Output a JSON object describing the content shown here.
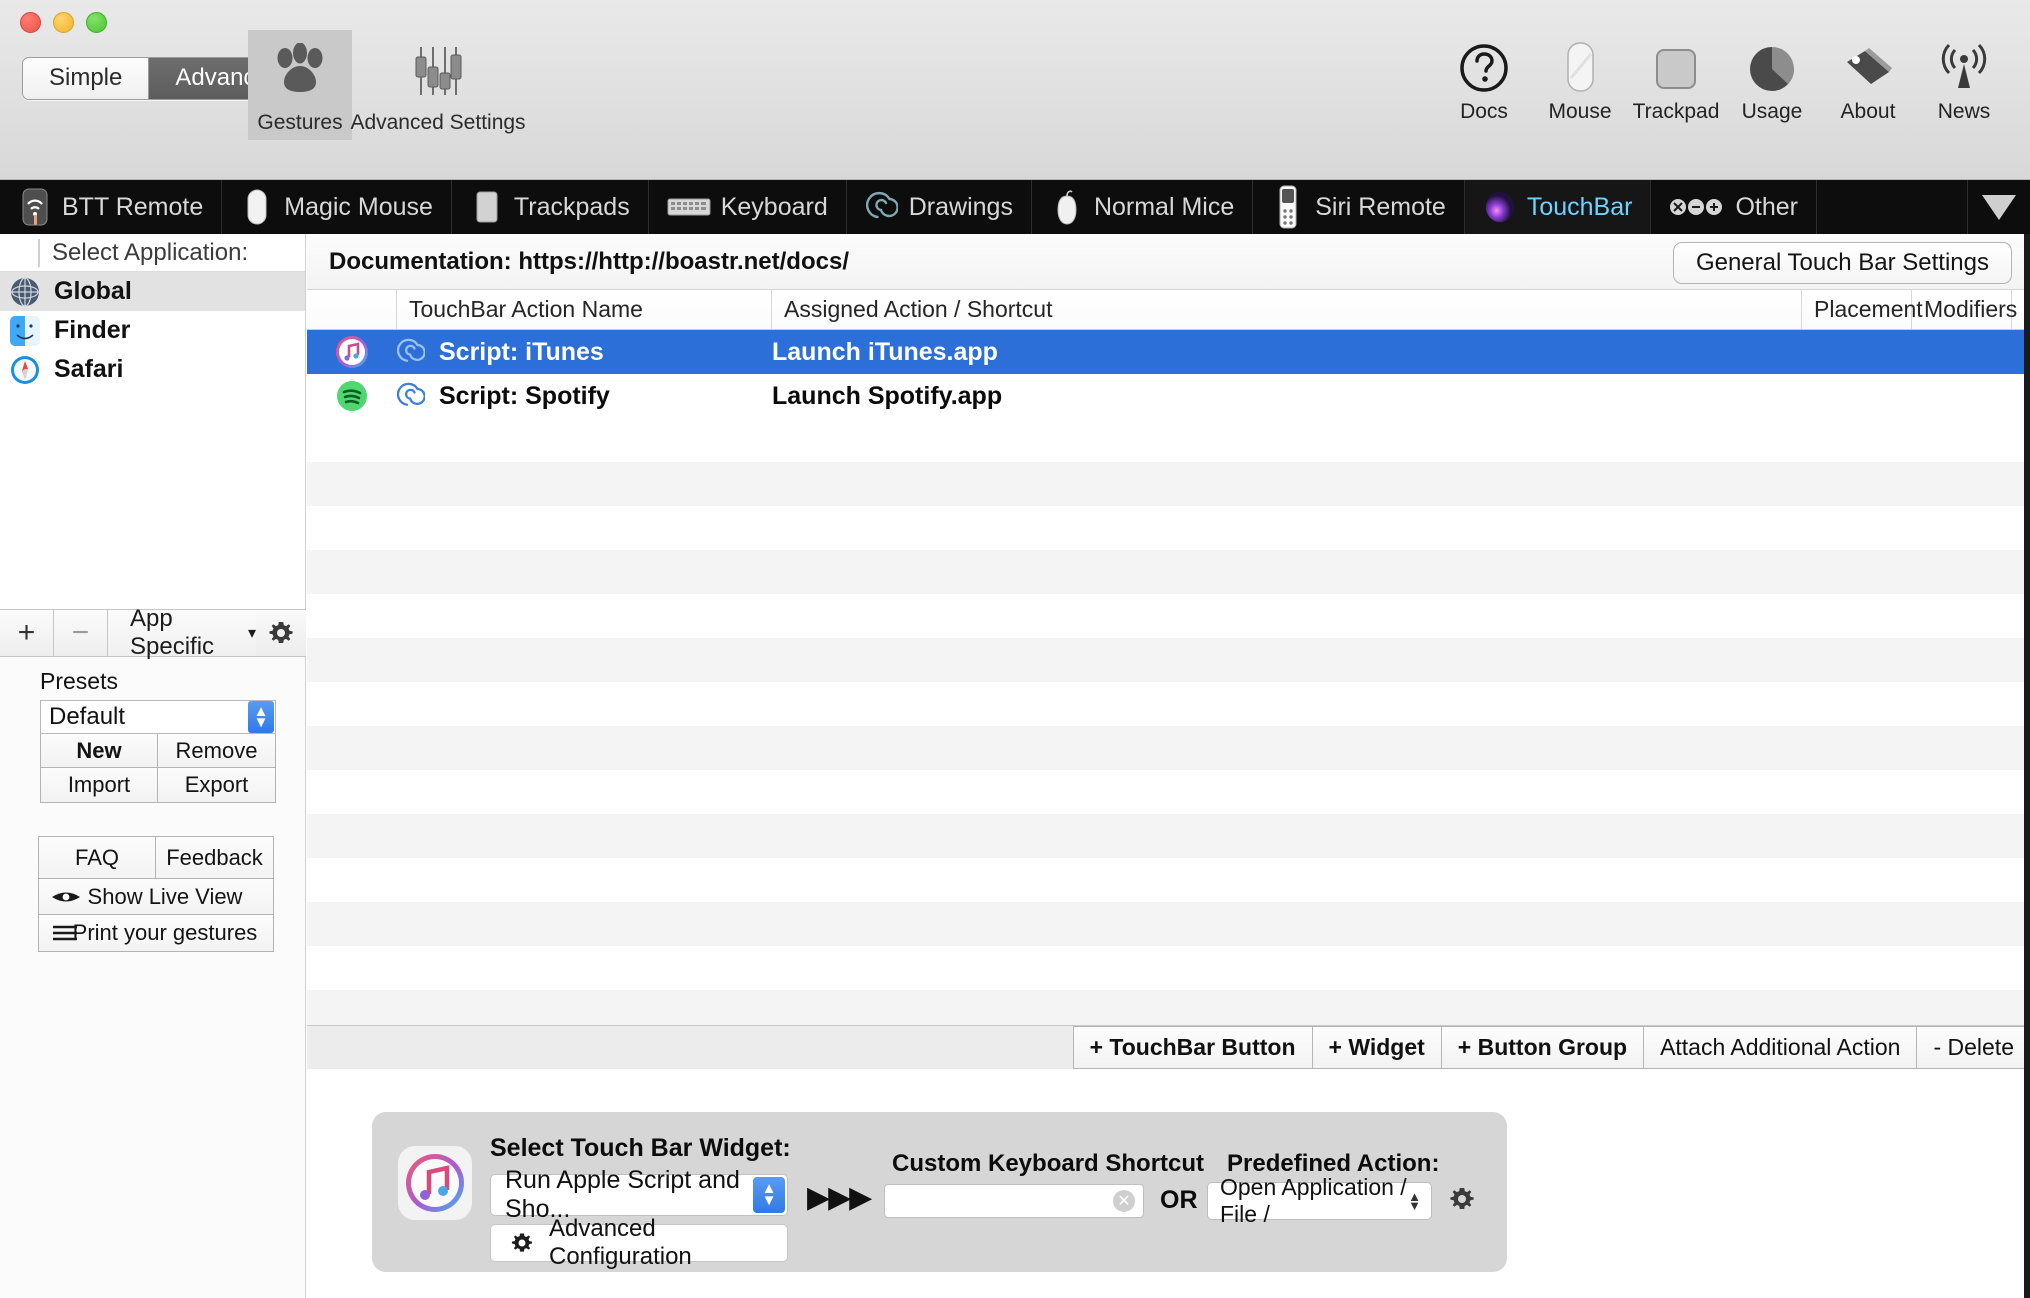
{
  "window": {
    "traffic_lights": [
      "close",
      "minimize",
      "zoom"
    ]
  },
  "toolbar": {
    "mode_segments": [
      {
        "label": "Simple",
        "active": false
      },
      {
        "label": "Advanced",
        "active": true
      }
    ],
    "left_items": [
      {
        "label": "Gestures",
        "icon": "paw-icon",
        "selected": true
      },
      {
        "label": "Advanced Settings",
        "icon": "sliders-icon",
        "selected": false
      }
    ],
    "right_items": [
      {
        "label": "Docs",
        "icon": "question-circle-icon"
      },
      {
        "label": "Mouse",
        "icon": "mouse-icon"
      },
      {
        "label": "Trackpad",
        "icon": "trackpad-icon"
      },
      {
        "label": "Usage",
        "icon": "pie-chart-icon"
      },
      {
        "label": "About",
        "icon": "tag-icon"
      },
      {
        "label": "News",
        "icon": "broadcast-icon"
      }
    ]
  },
  "device_tabs": {
    "items": [
      {
        "label": "BTT Remote",
        "icon": "btt-remote-icon",
        "active": false
      },
      {
        "label": "Magic Mouse",
        "icon": "magic-mouse-icon",
        "active": false
      },
      {
        "label": "Trackpads",
        "icon": "trackpad-icon",
        "active": false
      },
      {
        "label": "Keyboard",
        "icon": "keyboard-icon",
        "active": false
      },
      {
        "label": "Drawings",
        "icon": "spiral-icon",
        "active": false
      },
      {
        "label": "Normal Mice",
        "icon": "normal-mouse-icon",
        "active": false
      },
      {
        "label": "Siri Remote",
        "icon": "siri-remote-icon",
        "active": false
      },
      {
        "label": "TouchBar",
        "icon": "touchbar-orb-icon",
        "active": true
      },
      {
        "label": "Other",
        "icon": "other-dots-icon",
        "active": false
      }
    ],
    "overflow_icon": "triangle-down-icon",
    "active_color": "#6fd2ff"
  },
  "sidebar": {
    "header": "Select Application:",
    "apps": [
      {
        "label": "Global",
        "icon": "globe-icon",
        "selected": true
      },
      {
        "label": "Finder",
        "icon": "finder-icon",
        "selected": false
      },
      {
        "label": "Safari",
        "icon": "safari-icon",
        "selected": false
      }
    ],
    "toolbar": {
      "add_label": "+",
      "remove_label": "−",
      "popup_label": "App Specific",
      "popup_caret": "▾",
      "gear_icon": "gear-icon"
    },
    "presets": {
      "title": "Presets",
      "selected": "Default",
      "buttons": [
        {
          "label": "New",
          "bold": true
        },
        {
          "label": "Remove",
          "bold": false
        },
        {
          "label": "Import",
          "bold": false
        },
        {
          "label": "Export",
          "bold": false
        }
      ]
    },
    "help": {
      "faq": "FAQ",
      "feedback": "Feedback",
      "live_view": "Show Live View",
      "live_view_icon": "eye-icon",
      "print_gestures": "Print your gestures",
      "print_icon": "hamburger-lines-icon"
    }
  },
  "main": {
    "documentation": "Documentation: https://http://boastr.net/docs/",
    "general_settings_button": "General Touch Bar Settings",
    "table": {
      "columns": [
        "TouchBar Action Name",
        "Assigned Action / Shortcut",
        "Placement",
        "Modifiers"
      ],
      "rows": [
        {
          "app_icon": "itunes-icon",
          "type_icon": "spiral-icon",
          "name": "Script: iTunes",
          "assigned_action": "Launch iTunes.app",
          "placement": "",
          "modifiers": "",
          "selected": true
        },
        {
          "app_icon": "spotify-icon",
          "type_icon": "spiral-icon",
          "name": "Script: Spotify",
          "assigned_action": "Launch Spotify.app",
          "placement": "",
          "modifiers": "",
          "selected": false
        }
      ],
      "selection_color": "#2d6fd8"
    },
    "action_buttons": [
      {
        "label": "+ TouchBar Button",
        "bold": true
      },
      {
        "label": "+ Widget",
        "bold": true
      },
      {
        "label": "+ Button Group",
        "bold": true
      },
      {
        "label": "Attach Additional Action",
        "bold": false
      },
      {
        "label": "- Delete",
        "bold": false
      }
    ],
    "config_panel": {
      "app_icon": "itunes-icon",
      "widget_label": "Select Touch Bar Widget:",
      "widget_selected": "Run Apple Script and Sho...",
      "advanced_config_button": "Advanced Configuration",
      "advanced_config_icon": "gear-icon",
      "arrows": "▶▶▶",
      "shortcut_label": "Custom Keyboard Shortcut",
      "shortcut_value": "",
      "shortcut_clear_icon": "clear-circle-icon",
      "or_text": "OR",
      "predefined_label": "Predefined Action:",
      "predefined_selected": "Open Application / File /",
      "predefined_gear_icon": "gear-icon"
    }
  }
}
